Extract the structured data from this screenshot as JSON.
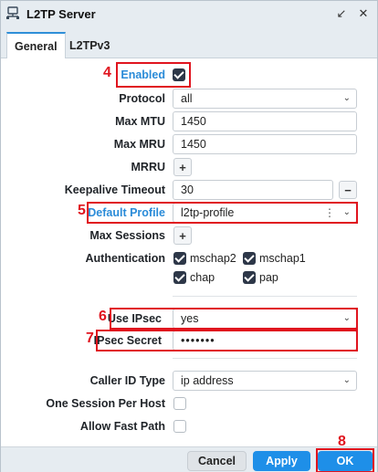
{
  "window": {
    "title": "L2TP Server",
    "restore_glyph": "↙",
    "close_glyph": "✕"
  },
  "tabs": [
    {
      "label": "General",
      "active": true
    },
    {
      "label": "L2TPv3",
      "active": false
    }
  ],
  "form": {
    "enabled": {
      "label": "Enabled",
      "checked": true
    },
    "protocol": {
      "label": "Protocol",
      "value": "all"
    },
    "max_mtu": {
      "label": "Max MTU",
      "value": "1450"
    },
    "max_mru": {
      "label": "Max MRU",
      "value": "1450"
    },
    "mrru": {
      "label": "MRRU",
      "add": "+"
    },
    "keepalive": {
      "label": "Keepalive Timeout",
      "value": "30",
      "remove": "−"
    },
    "default_profile": {
      "label": "Default Profile",
      "value": "l2tp-profile"
    },
    "max_sessions": {
      "label": "Max Sessions",
      "add": "+"
    },
    "authentication": {
      "label": "Authentication",
      "options": [
        {
          "label": "mschap2",
          "checked": true
        },
        {
          "label": "mschap1",
          "checked": true
        },
        {
          "label": "chap",
          "checked": true
        },
        {
          "label": "pap",
          "checked": true
        }
      ]
    },
    "use_ipsec": {
      "label": "Use IPsec",
      "value": "yes"
    },
    "ipsec_secret": {
      "label": "IPsec Secret",
      "value": "•••••••"
    },
    "caller_id_type": {
      "label": "Caller ID Type",
      "value": "ip address"
    },
    "one_session_per_host": {
      "label": "One Session Per Host",
      "checked": false
    },
    "allow_fast_path": {
      "label": "Allow Fast Path",
      "checked": false
    }
  },
  "footer": {
    "cancel": "Cancel",
    "apply": "Apply",
    "ok": "OK"
  },
  "annotations": {
    "n4": "4",
    "n5": "5",
    "n6": "6",
    "n7": "7",
    "n8": "8"
  },
  "colors": {
    "accent": "#1e8fe8",
    "annotation": "#e0141e",
    "label_blue": "#2a8bd8"
  },
  "icons": {
    "dropdown": "⌄",
    "menu": "⋮"
  }
}
